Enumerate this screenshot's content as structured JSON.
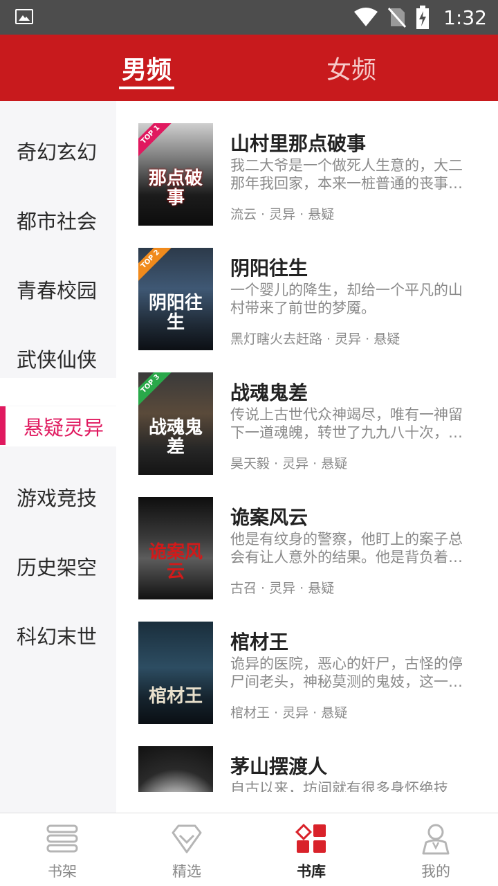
{
  "status_bar": {
    "time": "1:32",
    "icons": [
      "image-icon",
      "wifi-icon",
      "no-sim-icon",
      "battery-charging-icon"
    ]
  },
  "header": {
    "tabs": [
      {
        "label": "男频",
        "active": true
      },
      {
        "label": "女频",
        "active": false
      }
    ],
    "background_color": "#c81a1d"
  },
  "sidebar": {
    "categories": [
      {
        "label": "奇幻玄幻"
      },
      {
        "label": "都市社会"
      },
      {
        "label": "青春校园"
      },
      {
        "label": "武侠仙侠"
      },
      {
        "label": "悬疑灵异",
        "active": true
      },
      {
        "label": "游戏竞技"
      },
      {
        "label": "历史架空"
      },
      {
        "label": "科幻末世"
      }
    ],
    "active_color": "#e0195f"
  },
  "books": [
    {
      "title": "山村里那点破事",
      "description": "我二大爷是一个做死人生意的，大二那年我回家，本来一桩普通的丧事…",
      "meta": "流云 · 灵异 · 悬疑",
      "badge": "TOP 1",
      "badge_color": "#e0195f",
      "cover_text": "那点破事"
    },
    {
      "title": "阴阳往生",
      "description": "一个婴儿的降生，却给一个平凡的山村带来了前世的梦魇。",
      "meta": "黑灯瞎火去赶路 · 灵异 · 悬疑",
      "badge": "TOP 2",
      "badge_color": "#f08a1c",
      "cover_text": "阴阳往生"
    },
    {
      "title": "战魂鬼差",
      "description": "传说上古世代众神竭尽，唯有一神留下一道魂魄，转世了九九八十次，…",
      "meta": "昊天毅 · 灵异 · 悬疑",
      "badge": "TOP 3",
      "badge_color": "#2aa84a",
      "cover_text": "战魂鬼差"
    },
    {
      "title": "诡案风云",
      "description": "他是有纹身的警察，他盯上的案子总会有让人意外的结果。他是背负着…",
      "meta": "古召 · 灵异 · 悬疑",
      "badge": "",
      "badge_color": "",
      "cover_text": "诡案风云"
    },
    {
      "title": "棺材王",
      "description": "诡异的医院，恶心的奸尸，古怪的停尸间老头，神秘莫测的鬼妓，这一…",
      "meta": "棺材王 · 灵异 · 悬疑",
      "badge": "",
      "badge_color": "",
      "cover_text": "棺材王"
    },
    {
      "title": "茅山摆渡人",
      "description": "自古以来，坊间就有很多身怀绝技的…",
      "meta": "",
      "badge": "",
      "badge_color": "",
      "cover_text": ""
    }
  ],
  "bottom_nav": [
    {
      "label": "书架",
      "icon": "bookshelf-icon"
    },
    {
      "label": "精选",
      "icon": "diamond-icon"
    },
    {
      "label": "书库",
      "icon": "library-grid-icon",
      "active": true
    },
    {
      "label": "我的",
      "icon": "profile-icon"
    }
  ]
}
